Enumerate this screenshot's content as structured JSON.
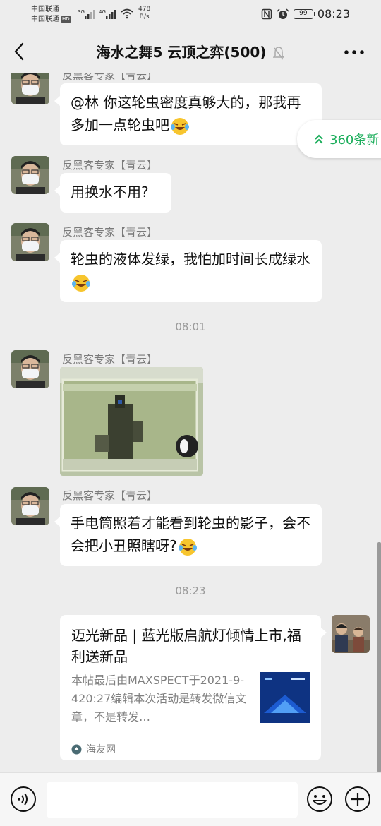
{
  "status_bar": {
    "carrier1": "中国联通",
    "carrier2": "中国联通",
    "carrier2_badge": "HD",
    "sig1": "3G",
    "sig2": "4G",
    "net_speed_value": "478",
    "net_speed_unit": "B/s",
    "battery": "99",
    "time": "08:23"
  },
  "nav": {
    "title": "海水之舞5 云顶之弈(500)"
  },
  "new_messages": {
    "label": "360条新"
  },
  "messages": [
    {
      "sender": "反黑客专家【青云】",
      "text": "@林  你这轮虫密度真够大的，那我再多加一点轮虫吧"
    },
    {
      "sender": "反黑客专家【青云】",
      "text": "用换水不用?"
    },
    {
      "sender": "反黑客专家【青云】",
      "text": "轮虫的液体发绿，我怕加时间长成绿水"
    },
    {
      "sender": "反黑客专家【青云】"
    },
    {
      "sender": "反黑客专家【青云】",
      "text": "手电筒照着才能看到轮虫的影子，会不会把小丑照瞎呀?"
    }
  ],
  "timestamps": [
    "08:01",
    "08:23"
  ],
  "card": {
    "title": "迈光新品 | 蓝光版启航灯倾情上市,福利送新品",
    "description": "本帖最后由MAXSPECT于2021-9-420:27编辑本次活动是转发微信文章，不是转发…",
    "source": "海友网"
  },
  "colors": {
    "background": "#ededed",
    "bubble": "#ffffff",
    "accent_green": "#1aad5a"
  }
}
